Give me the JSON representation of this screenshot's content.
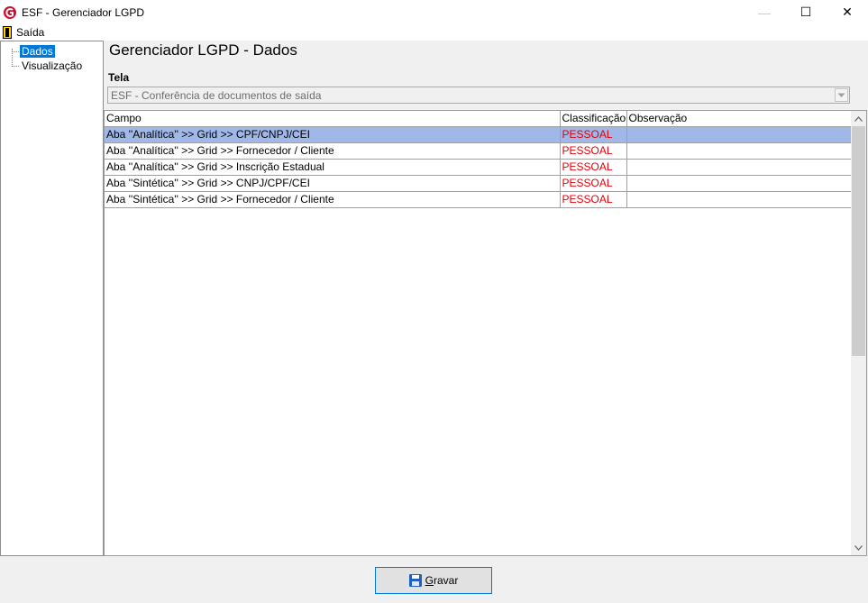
{
  "window": {
    "title": "ESF - Gerenciador LGPD",
    "controls": {
      "minimize": "—",
      "maximize": "☐",
      "close": "✕"
    }
  },
  "menu": {
    "items": [
      {
        "label": "Saída",
        "icon": "exit-door-icon"
      }
    ]
  },
  "sidebar": {
    "items": [
      {
        "label": "Dados",
        "selected": true
      },
      {
        "label": "Visualização",
        "selected": false
      }
    ]
  },
  "main": {
    "title": "Gerenciador LGPD - Dados",
    "tela_label": "Tela",
    "tela_value": "ESF - Conferência de documentos de saída"
  },
  "grid": {
    "columns": [
      "Campo",
      "Classificação",
      "Observação"
    ],
    "rows": [
      {
        "campo": "Aba ''Analítica'' >> Grid >> CPF/CNPJ/CEI",
        "classificacao": "PESSOAL",
        "observacao": "",
        "selected": true
      },
      {
        "campo": "Aba ''Analítica'' >> Grid >> Fornecedor / Cliente",
        "classificacao": "PESSOAL",
        "observacao": "",
        "selected": false
      },
      {
        "campo": "Aba ''Analítica'' >> Grid >> Inscrição Estadual",
        "classificacao": "PESSOAL",
        "observacao": "",
        "selected": false
      },
      {
        "campo": "Aba ''Sintética'' >> Grid >>  CNPJ/CPF/CEI",
        "classificacao": "PESSOAL",
        "observacao": "",
        "selected": false
      },
      {
        "campo": "Aba ''Sintética'' >> Grid >> Fornecedor / Cliente",
        "classificacao": "PESSOAL",
        "observacao": "",
        "selected": false
      }
    ]
  },
  "footer": {
    "save_label": "Gravar",
    "save_icon": "floppy-disk-icon"
  },
  "colors": {
    "selection": "#a0b8e8",
    "classification": "#e0000a",
    "tree_selection": "#0078d7"
  }
}
